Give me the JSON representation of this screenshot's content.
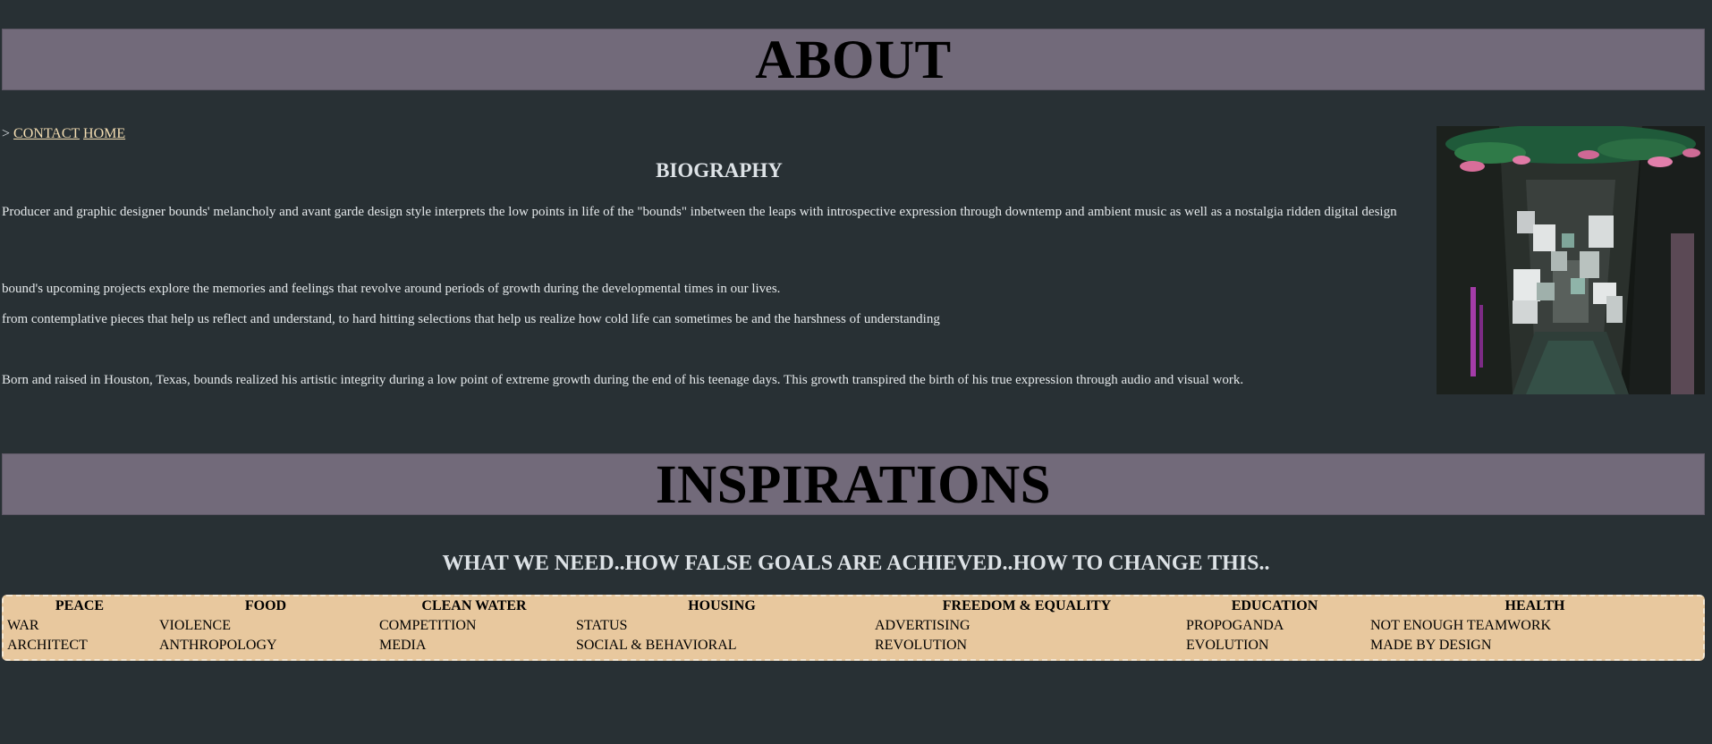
{
  "about": {
    "title": "ABOUT"
  },
  "nav": {
    "prefix": ">",
    "links": [
      {
        "label": "CONTACT"
      },
      {
        "label": "HOME"
      }
    ]
  },
  "biography": {
    "heading": "BIOGRAPHY",
    "paragraphs": [
      "Producer and graphic designer bounds' melancholy and avant garde design style interprets the low points in life of the \"bounds\" inbetween the leaps with introspective expression through downtemp and ambient music as well as a nostalgia ridden digital design",
      "bound's upcoming projects explore the memories and feelings that revolve around periods of growth during the developmental times in our lives.",
      "from contemplative pieces that help us reflect and understand, to hard hitting selections that help us realize how cold life can sometimes be and the harshness of understanding",
      "Born and raised in Houston, Texas, bounds realized his artistic integrity during a low point of extreme growth during the end of his teenage days. This growth transpired the birth of his true expression through audio and visual work."
    ]
  },
  "inspirations": {
    "title": "INSPIRATIONS",
    "subtitle": "WHAT WE NEED..HOW FALSE GOALS ARE ACHIEVED..HOW TO CHANGE THIS..",
    "table": {
      "headers": [
        "PEACE",
        "FOOD",
        "CLEAN WATER",
        "HOUSING",
        "FREEDOM & EQUALITY",
        "EDUCATION",
        "HEALTH"
      ],
      "rows": [
        [
          "WAR",
          "VIOLENCE",
          "COMPETITION",
          "STATUS",
          "ADVERTISING",
          "PROPOGANDA",
          "NOT ENOUGH TEAMWORK"
        ],
        [
          "ARCHITECT",
          "ANTHROPOLOGY",
          "MEDIA",
          "SOCIAL & BEHAVIORAL",
          "REVOLUTION",
          "EVOLUTION",
          "MADE BY DESIGN"
        ]
      ]
    }
  },
  "colors": {
    "background": "#283034",
    "banner": "#726a7a",
    "link": "#f3ddb2",
    "table_bg": "#e8c89e"
  }
}
